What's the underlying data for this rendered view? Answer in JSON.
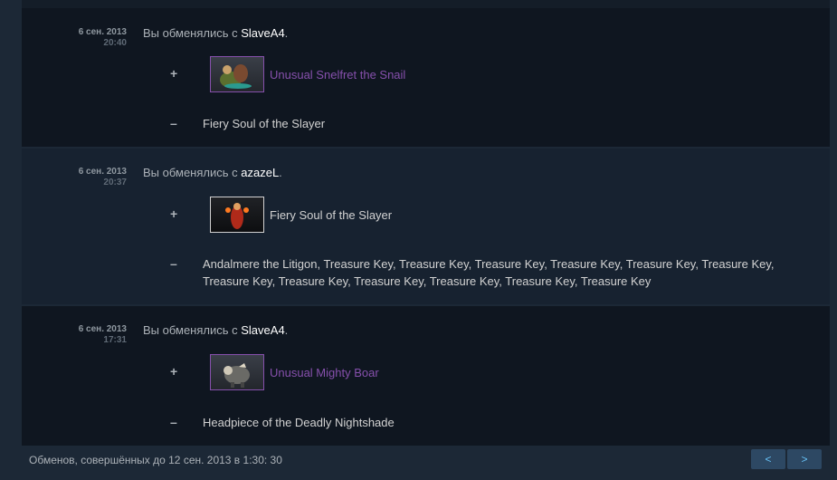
{
  "trades": [
    {
      "date": "6 сен. 2013",
      "time": "20:40",
      "prefix": "Вы обменялись с ",
      "partner": "SlaveA4",
      "suffix": ".",
      "received_sign": "+",
      "received_item": "Unusual Snelfret the Snail",
      "given_sign": "–",
      "given_items": "Fiery Soul of the Slayer"
    },
    {
      "date": "6 сен. 2013",
      "time": "20:37",
      "prefix": "Вы обменялись с ",
      "partner": "azazeL",
      "suffix": ".",
      "received_sign": "+",
      "received_item": "Fiery Soul of the Slayer",
      "given_sign": "–",
      "given_items_line1": "Andalmere the Litigon, Treasure Key, Treasure Key, Treasure Key, Treasure Key, Treasure Key, Treasure Key,",
      "given_items_line2": "Treasure Key, Treasure Key, Treasure Key, Treasure Key, Treasure Key, Treasure Key"
    },
    {
      "date": "6 сен. 2013",
      "time": "17:31",
      "prefix": "Вы обменялись с ",
      "partner": "SlaveA4",
      "suffix": ".",
      "received_sign": "+",
      "received_item": "Unusual Mighty Boar",
      "given_sign": "–",
      "given_items": "Headpiece of the Deadly Nightshade"
    }
  ],
  "footer": {
    "text": "Обменов, совершённых до 12 сен. 2013 в 1:30: 30",
    "prev_label": "<",
    "next_label": ">"
  },
  "colors": {
    "unusual": "#8650ac",
    "normal_item": "#d2d2d2",
    "partner": "#ffffff"
  }
}
